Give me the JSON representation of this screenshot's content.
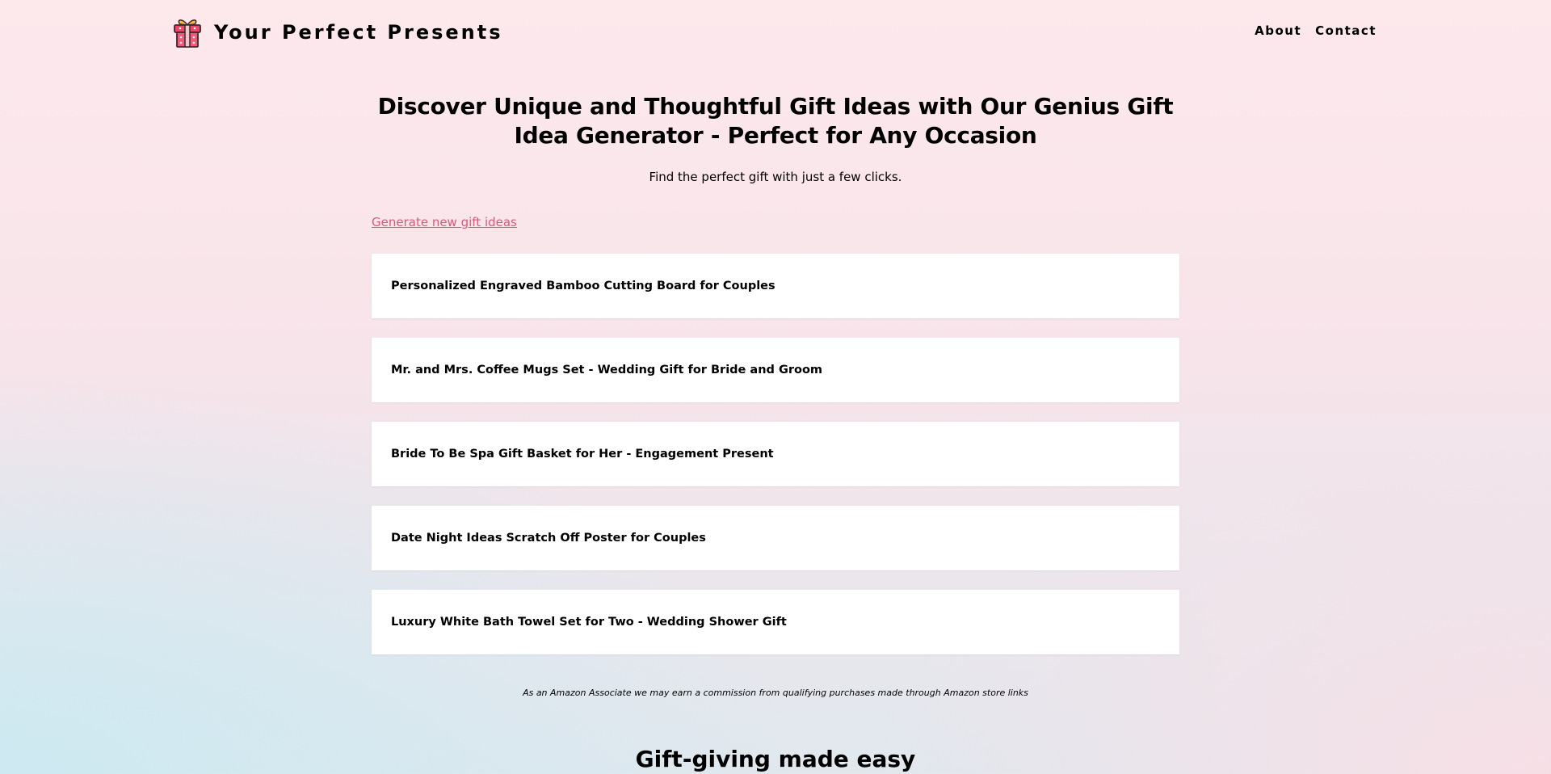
{
  "header": {
    "brand_title": "Your Perfect Presents",
    "logo_icon": "gift-icon",
    "nav": [
      {
        "label": "About"
      },
      {
        "label": "Contact"
      }
    ]
  },
  "hero": {
    "title": "Discover Unique and Thoughtful Gift Ideas with Our Genius Gift Idea Generator - Perfect for Any Occasion",
    "subtitle": "Find the perfect gift with just a few clicks."
  },
  "generate_link": "Generate new gift ideas",
  "ideas": [
    {
      "title": "Personalized Engraved Bamboo Cutting Board for Couples"
    },
    {
      "title": "Mr. and Mrs. Coffee Mugs Set - Wedding Gift for Bride and Groom"
    },
    {
      "title": "Bride To Be Spa Gift Basket for Her - Engagement Present"
    },
    {
      "title": "Date Night Ideas Scratch Off Poster for Couples"
    },
    {
      "title": "Luxury White Bath Towel Set for Two - Wedding Shower Gift"
    }
  ],
  "disclaimer": "As an Amazon Associate we may earn a commission from qualifying purchases made through Amazon store links",
  "section_title": "Gift-giving made easy",
  "colors": {
    "link": "#e0557a",
    "gift_body": "#e8496a",
    "gift_ribbon": "#f6b34c"
  }
}
